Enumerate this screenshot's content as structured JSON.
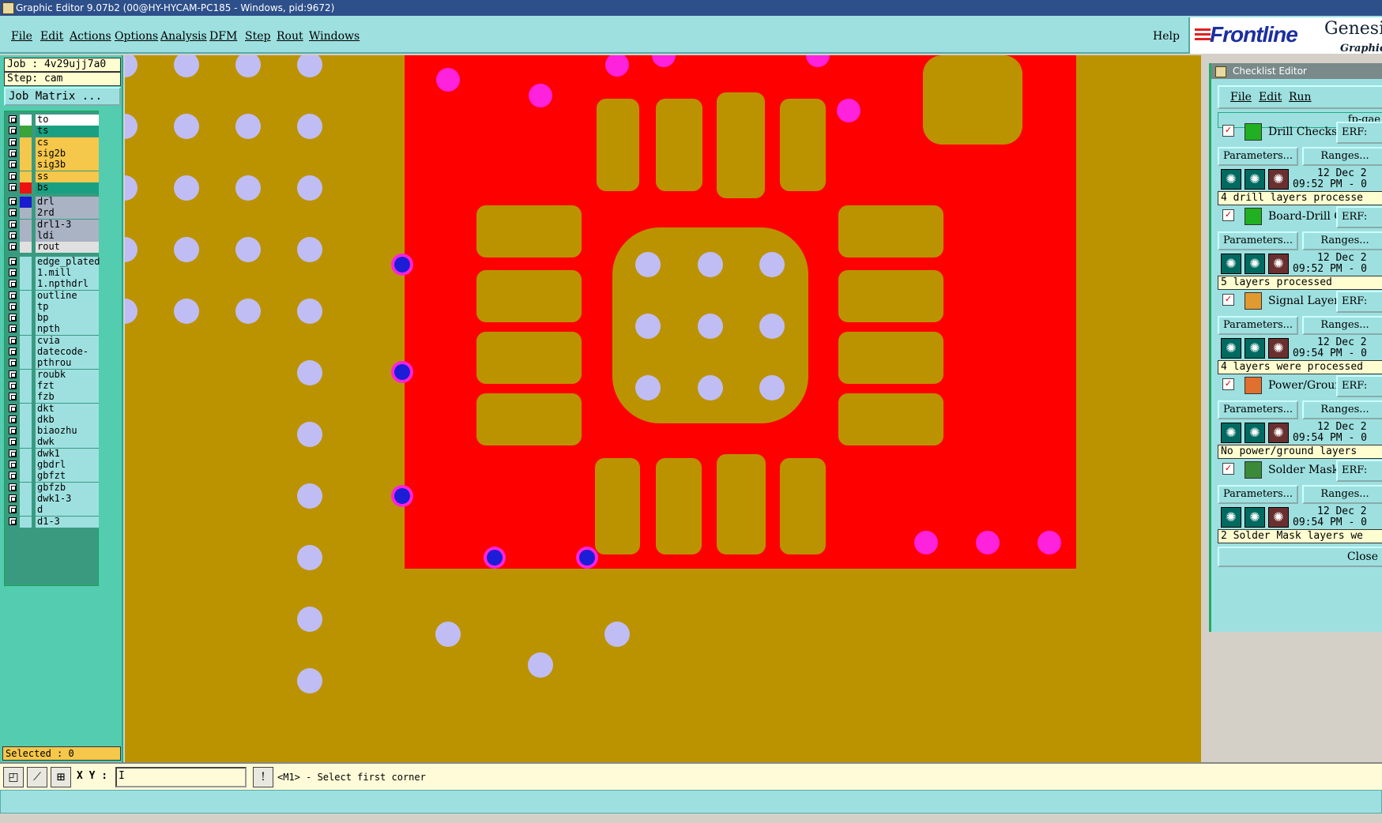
{
  "window_title": "Graphic Editor 9.07b2 (00@HY-HYCAM-PC185 - Windows, pid:9672)",
  "menu": [
    "File",
    "Edit",
    "Actions",
    "Options",
    "Analysis",
    "DFM",
    "Step",
    "Rout",
    "Windows"
  ],
  "help_label": "Help",
  "logo": {
    "brand": "Frontline",
    "product": "Genesi",
    "subtitle": "Graphic"
  },
  "job": {
    "job_text": "Job : 4v29ujj7a0",
    "step_text": "Step: cam",
    "matrix_button": "Job Matrix ..."
  },
  "layers": [
    {
      "name": "to",
      "color": "#ffffff",
      "bg": "#ffffff"
    },
    {
      "name": "ts",
      "color": "#3aa33a",
      "bg": "#19a082"
    },
    {
      "name": "cs",
      "color": "#f5c74a",
      "bg": "#f5c74a"
    },
    {
      "name": "sig2b",
      "color": "#f5c74a",
      "bg": "#f5c74a"
    },
    {
      "name": "sig3b",
      "color": "#f5c74a",
      "bg": "#f5c74a"
    },
    {
      "name": "ss",
      "color": "#f5c74a",
      "bg": "#f5c74a"
    },
    {
      "name": "bs",
      "color": "#ee1111",
      "bg": "#19a082"
    },
    {
      "name": "drl",
      "color": "#1b1bd0",
      "bg": "#aab3c4"
    },
    {
      "name": "2rd",
      "color": "#aab3c4",
      "bg": "#aab3c4"
    },
    {
      "name": "drl1-3",
      "color": "#aab3c4",
      "bg": "#aab3c4"
    },
    {
      "name": "ldi",
      "color": "#aab3c4",
      "bg": "#aab3c4"
    },
    {
      "name": "rout",
      "color": "#e0e0e0",
      "bg": "#e0e0e0"
    },
    {
      "name": "edge_plated",
      "color": "#9ee0e0",
      "bg": "#9ee0e0"
    },
    {
      "name": "1.mill",
      "color": "#9ee0e0",
      "bg": "#9ee0e0"
    },
    {
      "name": "1.npthdrl",
      "color": "#9ee0e0",
      "bg": "#9ee0e0"
    },
    {
      "name": "outline",
      "color": "#9ee0e0",
      "bg": "#9ee0e0"
    },
    {
      "name": "tp",
      "color": "#9ee0e0",
      "bg": "#9ee0e0"
    },
    {
      "name": "bp",
      "color": "#9ee0e0",
      "bg": "#9ee0e0"
    },
    {
      "name": "npth",
      "color": "#9ee0e0",
      "bg": "#9ee0e0"
    },
    {
      "name": "cvia",
      "color": "#9ee0e0",
      "bg": "#9ee0e0"
    },
    {
      "name": "datecode-to",
      "color": "#9ee0e0",
      "bg": "#9ee0e0"
    },
    {
      "name": "pthrou",
      "color": "#9ee0e0",
      "bg": "#9ee0e0"
    },
    {
      "name": "roubk",
      "color": "#9ee0e0",
      "bg": "#9ee0e0"
    },
    {
      "name": "fzt",
      "color": "#9ee0e0",
      "bg": "#9ee0e0"
    },
    {
      "name": "fzb",
      "color": "#9ee0e0",
      "bg": "#9ee0e0"
    },
    {
      "name": "dkt",
      "color": "#9ee0e0",
      "bg": "#9ee0e0"
    },
    {
      "name": "dkb",
      "color": "#9ee0e0",
      "bg": "#9ee0e0"
    },
    {
      "name": "biaozhu",
      "color": "#9ee0e0",
      "bg": "#9ee0e0"
    },
    {
      "name": "dwk",
      "color": "#9ee0e0",
      "bg": "#9ee0e0"
    },
    {
      "name": "dwk1",
      "color": "#9ee0e0",
      "bg": "#9ee0e0"
    },
    {
      "name": "gbdrl",
      "color": "#9ee0e0",
      "bg": "#9ee0e0"
    },
    {
      "name": "gbfzt",
      "color": "#9ee0e0",
      "bg": "#9ee0e0"
    },
    {
      "name": "gbfzb",
      "color": "#9ee0e0",
      "bg": "#9ee0e0"
    },
    {
      "name": "dwk1-3",
      "color": "#9ee0e0",
      "bg": "#9ee0e0"
    },
    {
      "name": "d",
      "color": "#9ee0e0",
      "bg": "#9ee0e0"
    },
    {
      "name": "d1-3",
      "color": "#9ee0e0",
      "bg": "#9ee0e0"
    }
  ],
  "selected_text": "Selected : 0",
  "bottom": {
    "xy_label": "X Y :",
    "xy_value": "I",
    "prompt": "<M1> - Select first corner"
  },
  "checklist": {
    "title": "Checklist Editor",
    "menu": [
      "File",
      "Edit",
      "Run"
    ],
    "name": "fp-qae",
    "parameters_label": "Parameters...",
    "ranges_label": "Ranges...",
    "erf_label": "ERF:",
    "close_label": "Close",
    "checks": [
      {
        "name": "Drill Checks",
        "date": "12 Dec 2",
        "time": "09:52 PM - 0",
        "status": "4 drill layers processe",
        "icon_color": "#21b021"
      },
      {
        "name": "Board-Drill Che",
        "date": "12 Dec 2",
        "time": "09:52 PM - 0",
        "status": "5 layers processed",
        "icon_color": "#21b021"
      },
      {
        "name": "Signal Layer Ch",
        "date": "12 Dec 2",
        "time": "09:54 PM - 0",
        "status": "4 layers were processed",
        "icon_color": "#e09a30"
      },
      {
        "name": "Power/Ground C",
        "date": "12 Dec 2",
        "time": "09:54 PM - 0",
        "status": "No power/ground layers",
        "icon_color": "#e07030"
      },
      {
        "name": "Solder Mask Ch",
        "date": "12 Dec 2",
        "time": "09:54 PM - 0",
        "status": "2 Solder Mask layers we",
        "icon_color": "#3a8a3a"
      }
    ]
  },
  "colors": {
    "copper": "#bb9300",
    "mask": "#ff0000",
    "drill_light": "#c0bdf5",
    "pad_magenta": "#ff22dd",
    "via_blue": "#1d1dd8"
  }
}
